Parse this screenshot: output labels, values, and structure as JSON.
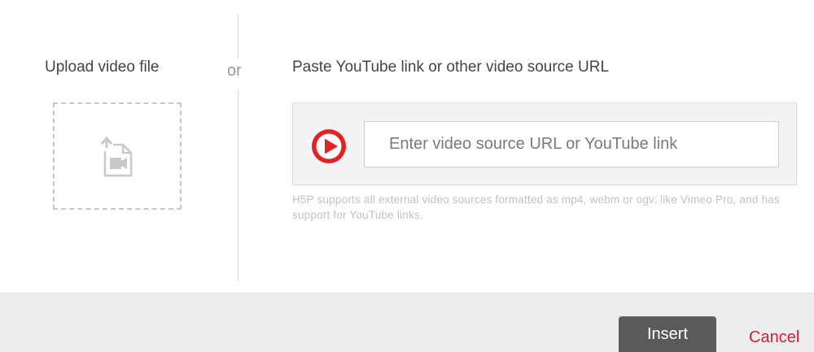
{
  "upload": {
    "title": "Upload video file",
    "icon": "upload-video-icon"
  },
  "separator": {
    "label": "or"
  },
  "url": {
    "title": "Paste YouTube link or other video source URL",
    "placeholder": "Enter video source URL or YouTube link",
    "value": "",
    "icon": "youtube-play-icon",
    "help_text": "H5P supports all external video sources formatted as mp4, webm or ogv, like Vimeo Pro, and has support for YouTube links."
  },
  "footer": {
    "insert_label": "Insert",
    "cancel_label": "Cancel"
  },
  "colors": {
    "play_icon": "#e02424",
    "cancel": "#d02032",
    "insert_button": "#5a5a5a",
    "footer_bg": "#ededed"
  }
}
